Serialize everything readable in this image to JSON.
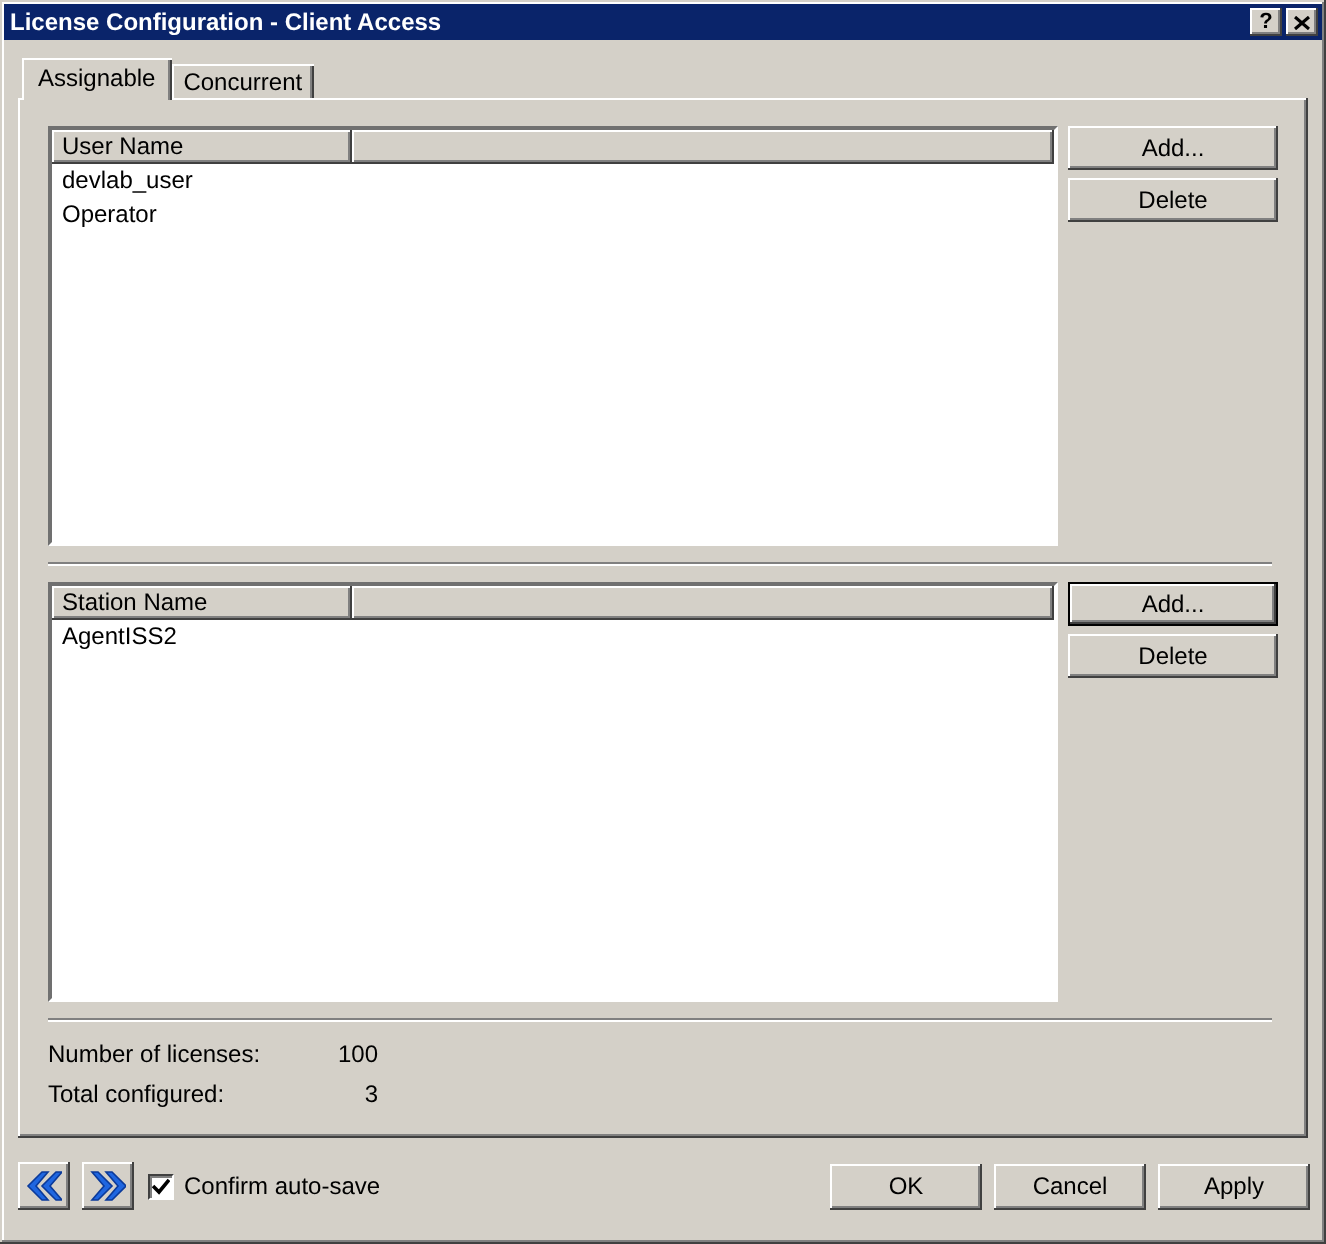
{
  "window": {
    "title": "License Configuration - Client Access",
    "help_button": "?"
  },
  "tabs": [
    {
      "label": "Assignable",
      "selected": true
    },
    {
      "label": "Concurrent",
      "selected": false
    }
  ],
  "lists": [
    {
      "columns": [
        "User Name"
      ],
      "rows": [
        "devlab_user",
        "Operator"
      ],
      "buttons": [
        {
          "label": "Add...",
          "default": false
        },
        {
          "label": "Delete",
          "default": false
        }
      ]
    },
    {
      "columns": [
        "Station Name"
      ],
      "rows": [
        "AgentISS2"
      ],
      "buttons": [
        {
          "label": "Add...",
          "default": true
        },
        {
          "label": "Delete",
          "default": false
        }
      ]
    }
  ],
  "summary": [
    {
      "label": "Number of licenses:",
      "value": "100"
    },
    {
      "label": "Total configured:",
      "value": "3"
    }
  ],
  "confirm_auto_save": {
    "label": "Confirm auto-save",
    "checked": true
  },
  "buttons": [
    "OK",
    "Cancel",
    "Apply"
  ]
}
